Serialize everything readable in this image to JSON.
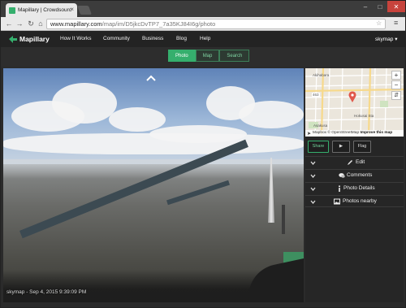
{
  "browser": {
    "tab_title": "Mapillary | Crowdsourc",
    "url_host": "www.mapillary.com",
    "url_path": "/map/im/D5jkcDvTP7_7a35KJ84I6g/photo"
  },
  "site": {
    "brand": "Mapillary",
    "nav": [
      "How It Works",
      "Community",
      "Business",
      "Blog",
      "Help"
    ],
    "user": "skymap"
  },
  "viewer": {
    "modes": [
      "Photo",
      "Map",
      "Search"
    ],
    "active_mode": "Photo",
    "caption": "skymap - Sep 4, 2015 9:39:09 PM"
  },
  "map": {
    "attribution_prefix": "Mapbox ",
    "attribution_mid": "© OpenStreetMap ",
    "improve_link": "Improve this map",
    "labels": [
      "Akihabara",
      "Hokusai Sta",
      "463",
      "Asakusa"
    ],
    "zoom_in": "+",
    "zoom_out": "−"
  },
  "controls": {
    "share": "Share",
    "play": "▶",
    "flag": "Flag"
  },
  "sections": [
    {
      "label": "Edit",
      "icon": "pencil-icon"
    },
    {
      "label": "Comments",
      "icon": "comments-icon"
    },
    {
      "label": "Photo Details",
      "icon": "info-icon"
    },
    {
      "label": "Photos nearby",
      "icon": "image-icon"
    }
  ],
  "colors": {
    "accent": "#35af6d",
    "header_bg": "#232323",
    "panel_bg": "#262626"
  }
}
